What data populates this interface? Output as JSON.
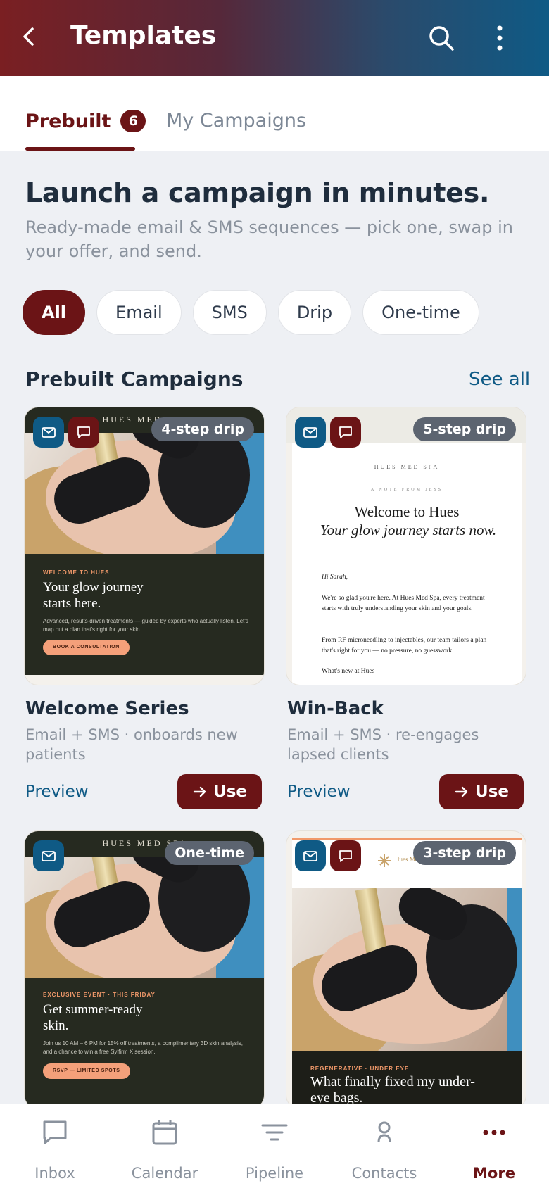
{
  "colors": {
    "brand": "#6b1416",
    "accent": "#0f5a85",
    "muted": "#8a929d"
  },
  "header": {
    "title": "Templates"
  },
  "tabs": {
    "prebuilt_label": "Prebuilt",
    "prebuilt_count": "6",
    "mine_label": "My Campaigns"
  },
  "hero": {
    "title": "Launch a campaign in minutes.",
    "subtitle": "Ready-made email & SMS sequences — pick one, swap in your offer, and send."
  },
  "filters": [
    "All",
    "Email",
    "SMS",
    "Drip",
    "One-time"
  ],
  "section": {
    "title": "Prebuilt Campaigns",
    "see_all": "See all"
  },
  "cards": [
    {
      "badge": "4-step drip",
      "icons": [
        "email-icon",
        "sms-icon"
      ],
      "name": "Welcome Series",
      "desc": "Email + SMS · onboards new patients",
      "preview": "Preview",
      "use": "Use",
      "thumb": {
        "brand": "HUES MED SPA",
        "kicker": "WELCOME TO HUES",
        "headline": "Your glow journey starts here.",
        "body": "Advanced, results-driven treatments — guided by experts who actually listen. Let's map out a plan that's right for your skin.",
        "button": "BOOK A CONSULTATION"
      }
    },
    {
      "badge": "5-step drip",
      "icons": [
        "email-icon",
        "sms-icon"
      ],
      "name": "Win-Back",
      "desc": "Email + SMS · re-engages lapsed clients",
      "preview": "Preview",
      "use": "Use",
      "thumb": {
        "brand": "HUES MED SPA",
        "note": "A NOTE FROM JESS",
        "headline": "Welcome to Hues",
        "subhead": "Your glow journey starts now.",
        "greeting": "Hi Sarah,",
        "p1": "We're so glad you're here. At Hues Med Spa, every treatment starts with truly understanding your skin and your goals.",
        "p2": "From RF microneedling to injectables, our team tailors a plan that's right for you — no pressure, no guesswork.",
        "p3": "What's new at Hues"
      }
    },
    {
      "badge": "One-time",
      "icons": [
        "email-icon"
      ],
      "thumb": {
        "brand": "HUES MED SPA",
        "kicker": "EXCLUSIVE EVENT · THIS FRIDAY",
        "headline": "Get summer-ready skin.",
        "body": "Join us 10 AM – 6 PM for 15% off treatments, a complimentary 3D skin analysis, and a chance to win a free Sylfirm X session.",
        "button": "RSVP — LIMITED SPOTS"
      }
    },
    {
      "badge": "3-step drip",
      "icons": [
        "email-icon",
        "sms-icon"
      ],
      "thumb": {
        "brand": "Hues Med Spa",
        "kicker": "REGENERATIVE · UNDER EYE",
        "headline": "What finally fixed my under-eye bags."
      }
    }
  ],
  "nav": [
    {
      "label": "Inbox",
      "icon": "chat-icon"
    },
    {
      "label": "Calendar",
      "icon": "calendar-icon"
    },
    {
      "label": "Pipeline",
      "icon": "filter-icon"
    },
    {
      "label": "Contacts",
      "icon": "person-icon"
    },
    {
      "label": "More",
      "icon": "more-dots-icon"
    }
  ]
}
